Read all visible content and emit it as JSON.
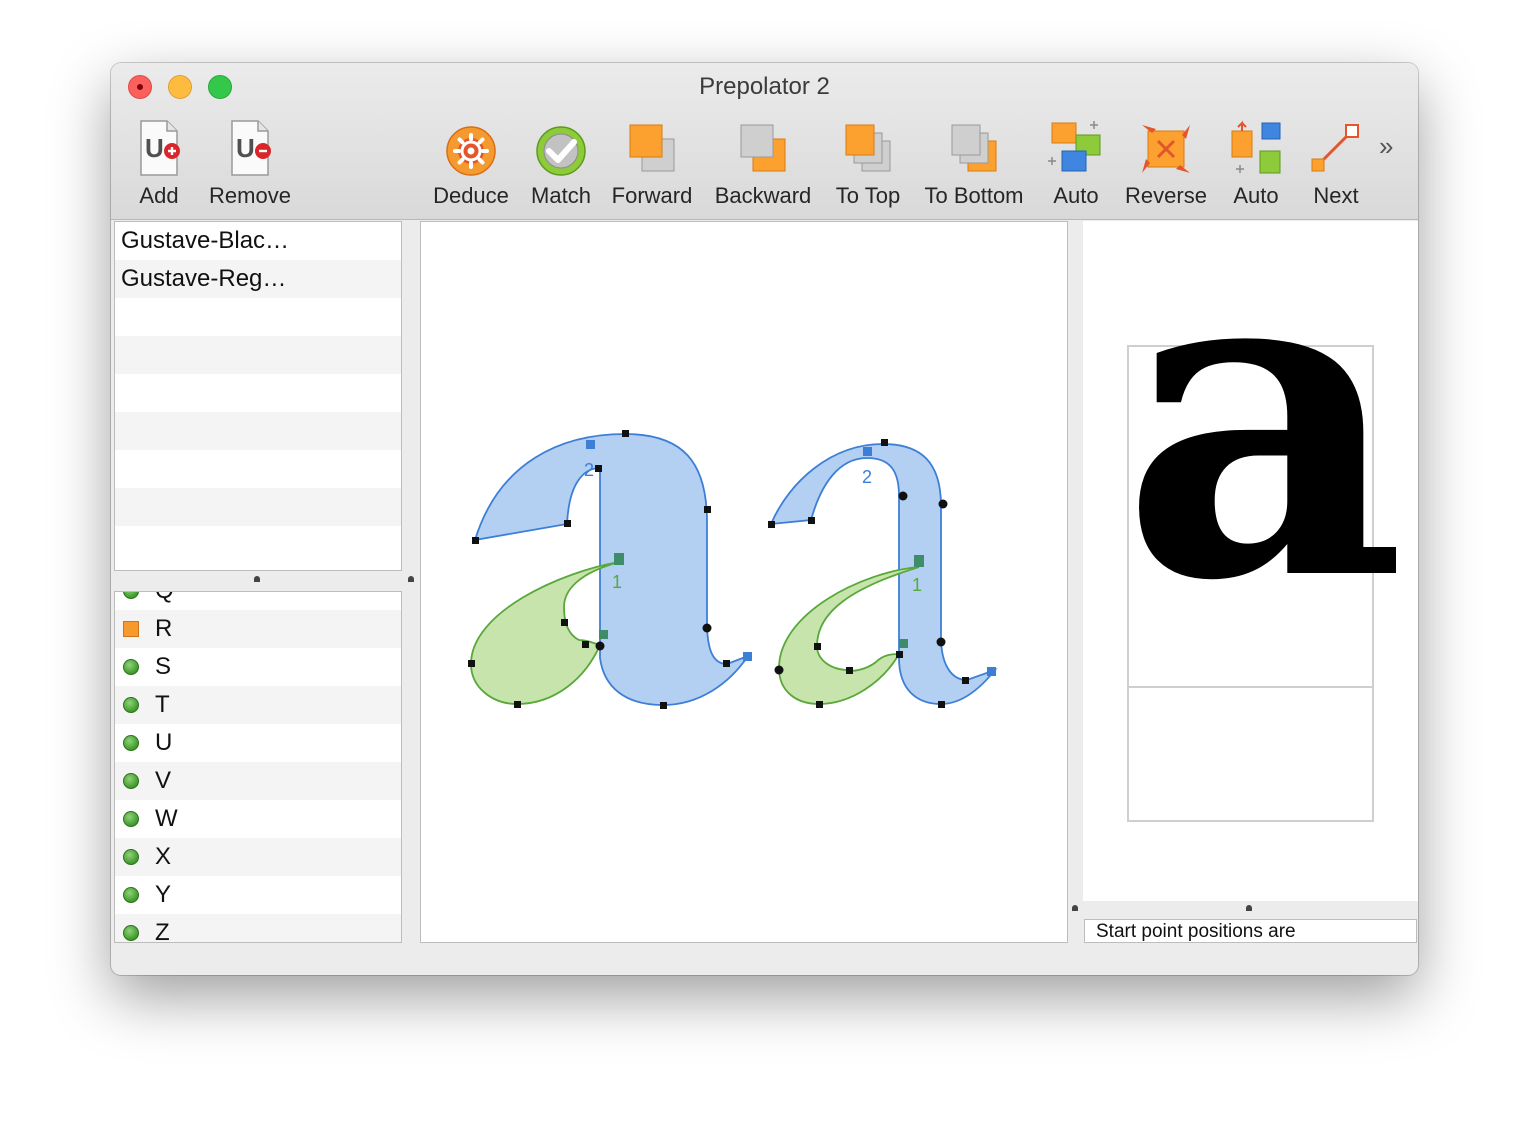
{
  "window": {
    "title": "Prepolator 2"
  },
  "toolbar": {
    "add": "Add",
    "remove": "Remove",
    "deduce": "Deduce",
    "match": "Match",
    "forward": "Forward",
    "backward": "Backward",
    "to_top": "To Top",
    "to_bottom": "To Bottom",
    "auto_1": "Auto",
    "reverse": "Reverse",
    "auto_2": "Auto",
    "next": "Next",
    "overflow": "»"
  },
  "fonts": [
    "Gustave-Blac…",
    "Gustave-Reg…"
  ],
  "glyphs": [
    {
      "name": "Q",
      "status": "ok"
    },
    {
      "name": "R",
      "status": "warning"
    },
    {
      "name": "S",
      "status": "ok"
    },
    {
      "name": "T",
      "status": "ok"
    },
    {
      "name": "U",
      "status": "ok"
    },
    {
      "name": "V",
      "status": "ok"
    },
    {
      "name": "W",
      "status": "ok"
    },
    {
      "name": "X",
      "status": "ok"
    },
    {
      "name": "Y",
      "status": "ok"
    },
    {
      "name": "Z",
      "status": "ok"
    }
  ],
  "canvas": {
    "contour_labels": {
      "blue": "2",
      "green": "1"
    },
    "colors": {
      "blue_fill": "#b3d0f3",
      "blue_stroke": "#3d7fd6",
      "green_fill": "#c3e3a6",
      "green_stroke": "#59a83a"
    }
  },
  "preview": {
    "glyph": "a"
  },
  "status": {
    "text": "Start point positions are"
  }
}
